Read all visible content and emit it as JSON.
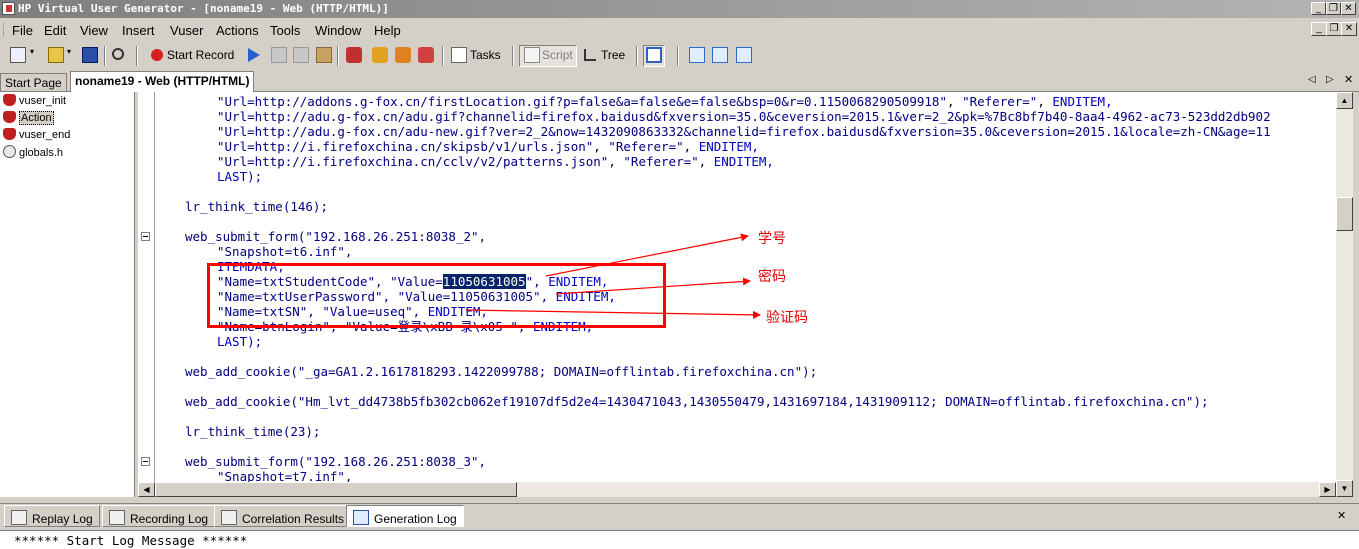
{
  "window": {
    "title": "HP Virtual User Generator - [noname19 - Web (HTTP/HTML)]"
  },
  "menu": [
    "File",
    "Edit",
    "View",
    "Insert",
    "Vuser",
    "Actions",
    "Tools",
    "Window",
    "Help"
  ],
  "toolbar": {
    "start_record": "Start Record",
    "tasks": "Tasks",
    "script": "Script",
    "tree": "Tree"
  },
  "tabs": {
    "start_page": "Start Page",
    "document": "noname19 - Web (HTTP/HTML)"
  },
  "tree": [
    "vuser_init",
    "Action",
    "vuser_end",
    "globals.h"
  ],
  "code": {
    "l1_url": "\"Url=http://addons.g-fox.cn/firstLocation.gif?p=false&a=false&e=false&bsp=0&r=0.1150068290509918\"",
    "l1_ref": "\"Referer=\"",
    "l2_url": "\"Url=http://adu.g-fox.cn/adu.gif?channelid=firefox.baidusd&fxversion=35.0&ceversion=2015.1&ver=2_2&pk=%7Bc8bf7b40-8aa4-4962-ac73-523dd2db902",
    "l3_url": "\"Url=http://adu.g-fox.cn/adu-new.gif?ver=2_2&now=1432090863332&channelid=firefox.baidusd&fxversion=35.0&ceversion=2015.1&locale=zh-CN&age=11",
    "l4_url": "\"Url=http://i.firefoxchina.cn/skipsb/v1/urls.json\"",
    "l4_ref": "\"Referer=\"",
    "l5_url": "\"Url=http://i.firefoxchina.cn/cclv/v2/patterns.json\"",
    "l5_ref": "\"Referer=\"",
    "enditem": "ENDITEM,",
    "last": "LAST);",
    "think1": "lr_think_time(146);",
    "submit1_fn": "web_submit_form(",
    "submit1_arg": "\"192.168.26.251:8038_2\",",
    "snapshot1": "\"Snapshot=t6.inf\",",
    "itemdata": "ITEMDATA,",
    "f1_name": "\"Name=txtStudentCode\",",
    "f1_val_pre": "\"Value=",
    "f1_val_sel": "11050631005",
    "f1_val_post": "\",",
    "f2_name": "\"Name=txtUserPassword\",",
    "f2_val": "\"Value=11050631005\",",
    "f3_name": "\"Name=txtSN\",",
    "f3_val": "\"Value=useq\",",
    "f4_name": "\"Name=btnLogin\",",
    "f4_val": "\"Value=登录\\xBB 录\\x05 \",",
    "cookie1_fn": "web_add_cookie(",
    "cookie1_arg": "\"_ga=GA1.2.1617818293.1422099788; DOMAIN=offlintab.firefoxchina.cn\");",
    "cookie2_fn": "web_add_cookie(",
    "cookie2_arg": "\"Hm_lvt_dd4738b5fb302cb062ef19107df5d2e4=1430471043,1430550479,1431697184,1431909112; DOMAIN=offlintab.firefoxchina.cn\");",
    "think2": "lr_think_time(23);",
    "submit2_fn": "web_submit_form(",
    "submit2_arg": "\"192.168.26.251:8038_3\",",
    "snapshot2": "\"Snapshot=t7.inf\","
  },
  "annotations": {
    "student_id": "学号",
    "password": "密码",
    "captcha": "验证码"
  },
  "bottom_tabs": [
    "Replay Log",
    "Recording Log",
    "Correlation Results",
    "Generation Log"
  ],
  "log": {
    "first_line": "****** Start Log Message ******"
  },
  "colors": {
    "selection": "#0a246a",
    "string": "#000080",
    "annotation": "#ff0000"
  }
}
